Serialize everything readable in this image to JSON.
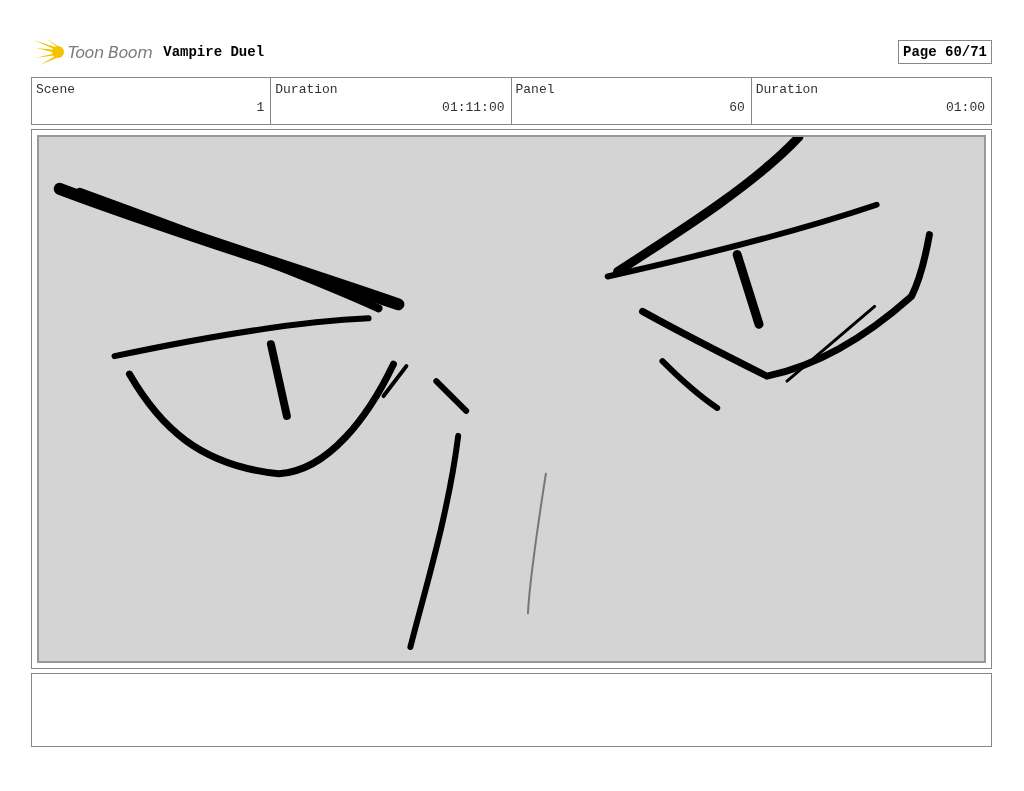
{
  "header": {
    "logo": "Toon Boom",
    "project_title": "Vampire Duel",
    "page": "Page 60/71"
  },
  "info_table": {
    "columns": [
      "Scene",
      "Duration",
      "Panel",
      "Duration"
    ],
    "rows": [
      [
        "1",
        "01:11:00",
        "60",
        "01:00"
      ]
    ]
  }
}
